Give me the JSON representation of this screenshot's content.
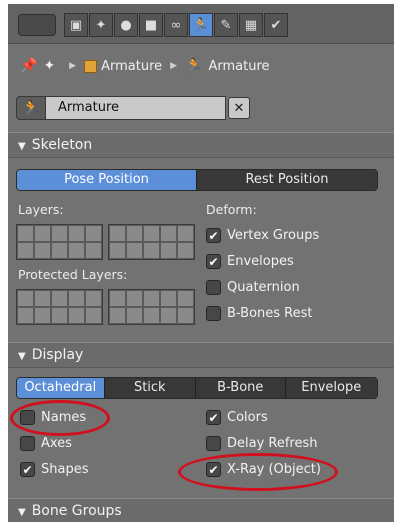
{
  "header": {
    "tabs": [
      {
        "icon": "render-icon",
        "glyph": "▣",
        "active": false
      },
      {
        "icon": "scene-icon",
        "glyph": "✦",
        "active": false
      },
      {
        "icon": "world-icon",
        "glyph": "●",
        "active": false
      },
      {
        "icon": "object-icon",
        "glyph": "■",
        "active": false
      },
      {
        "icon": "constraints-icon",
        "glyph": "∞",
        "active": false
      },
      {
        "icon": "armature-data-icon",
        "glyph": "🏃",
        "active": true
      },
      {
        "icon": "bone-icon",
        "glyph": "✎",
        "active": false
      },
      {
        "icon": "texture-icon",
        "glyph": "▦",
        "active": false
      },
      {
        "icon": "bone-constraint-icon",
        "glyph": "✔",
        "active": false
      }
    ]
  },
  "breadcrumb": {
    "object_label": "Armature",
    "data_label": "Armature"
  },
  "datablock": {
    "name": "Armature",
    "clear_glyph": "✕"
  },
  "skeleton": {
    "title": "Skeleton",
    "position_modes": [
      "Pose Position",
      "Rest Position"
    ],
    "active_position_mode": "Pose Position",
    "layers_label": "Layers:",
    "protected_layers_label": "Protected Layers:",
    "deform_label": "Deform:",
    "deform_options": [
      {
        "label": "Vertex Groups",
        "checked": true
      },
      {
        "label": "Envelopes",
        "checked": true
      },
      {
        "label": "Quaternion",
        "checked": false
      },
      {
        "label": "B-Bones Rest",
        "checked": false
      }
    ]
  },
  "display": {
    "title": "Display",
    "draw_types": [
      "Octahedral",
      "Stick",
      "B-Bone",
      "Envelope"
    ],
    "active_draw_type": "Octahedral",
    "left_options": [
      {
        "label": "Names",
        "checked": false
      },
      {
        "label": "Axes",
        "checked": false
      },
      {
        "label": "Shapes",
        "checked": true
      }
    ],
    "right_options": [
      {
        "label": "Colors",
        "checked": true
      },
      {
        "label": "Delay Refresh",
        "checked": false
      },
      {
        "label": "X-Ray (Object)",
        "checked": true
      }
    ]
  },
  "bone_groups": {
    "title": "Bone Groups"
  },
  "colors": {
    "accent": "#5d8fd8",
    "highlight": "#d0101e",
    "panel_bg": "#727272"
  }
}
